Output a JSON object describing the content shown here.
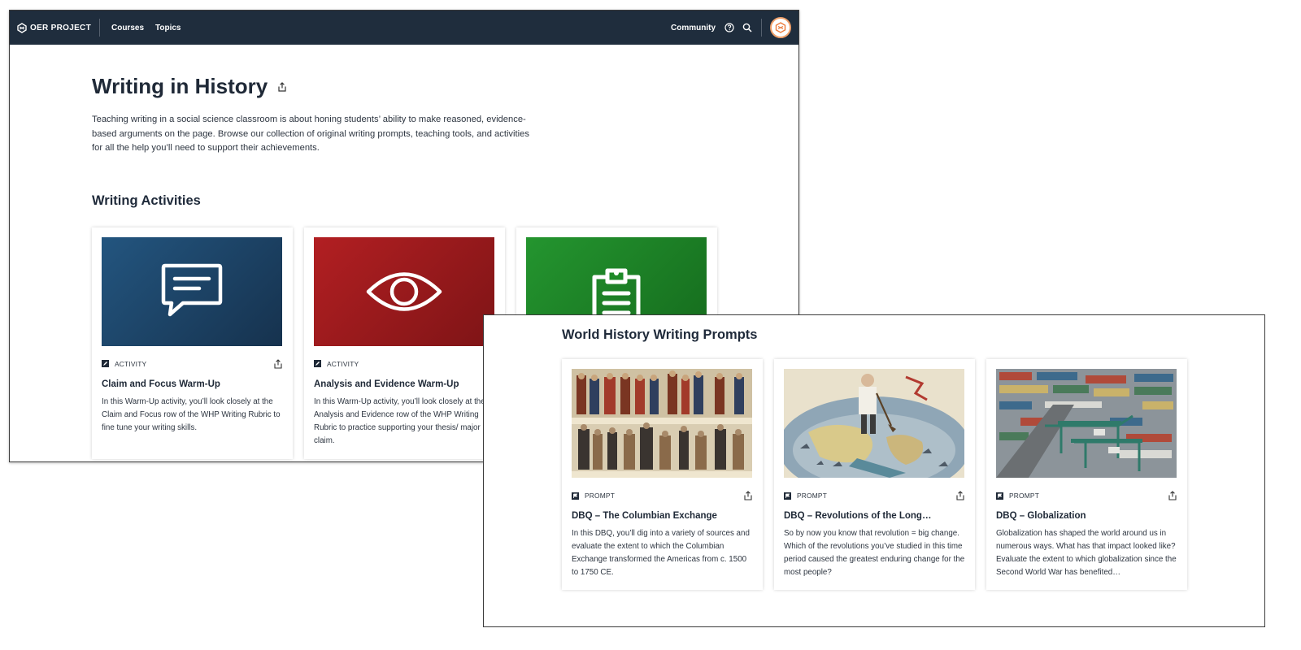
{
  "nav": {
    "logo_text": "OER PROJECT",
    "links": [
      "Courses",
      "Topics"
    ],
    "community": "Community"
  },
  "page": {
    "title": "Writing in History",
    "intro": "Teaching writing in a social science classroom is about honing students’ ability to make reasoned, evidence-based arguments on the page. Browse our collection of original writing prompts, teaching tools, and activities for all the help you’ll need to support their achievements."
  },
  "activities": {
    "section_title": "Writing Activities",
    "cards": [
      {
        "tile_color": "#1e4a70",
        "tile_icon": "chat-bubble-icon",
        "type": "ACTIVITY",
        "title": "Claim and Focus Warm-Up",
        "desc": "In this Warm-Up activity, you’ll look closely at the Claim and Focus row of the WHP Writing Rubric to fine tune your writing skills."
      },
      {
        "tile_color": "#a51d20",
        "tile_icon": "eye-icon",
        "type": "ACTIVITY",
        "title": "Analysis and Evidence Warm-Up",
        "desc": "In this Warm-Up activity, you’ll look closely at the Analysis and Evidence row of the WHP Writing Rubric to practice supporting your thesis/ major claim."
      },
      {
        "tile_color": "#1f8a2b",
        "tile_icon": "clipboard-icon"
      }
    ]
  },
  "prompts": {
    "section_title": "World History Writing Prompts",
    "cards": [
      {
        "image": "casta-painting-image",
        "type": "PROMPT",
        "title": "DBQ – The Columbian Exchange",
        "desc": "In this DBQ, you’ll dig into a variety of sources and evaluate the extent to which the Columbian Exchange transformed the Americas from c. 1500 to 1750 CE."
      },
      {
        "image": "political-cartoon-image",
        "type": "PROMPT",
        "title": "DBQ – Revolutions of the Long…",
        "desc": "So by now you know that revolution = big change. Which of the revolutions you’ve studied in this time period caused the greatest enduring change for the most people?"
      },
      {
        "image": "container-port-image",
        "type": "PROMPT",
        "title": "DBQ – Globalization",
        "desc": "Globalization has shaped the world around us in numerous ways. What has that impact looked like? Evaluate the extent to which globalization since the Second World War has benefited…"
      }
    ]
  }
}
